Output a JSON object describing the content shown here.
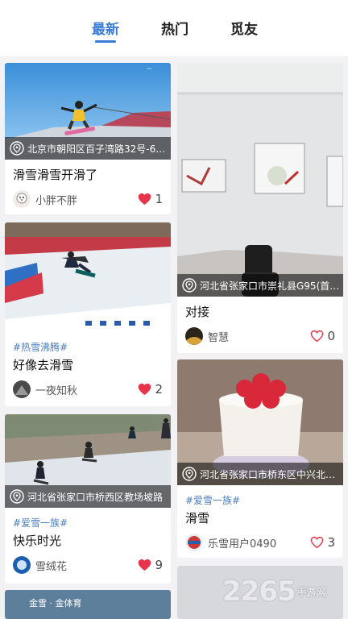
{
  "tabs": [
    {
      "label": "最新",
      "active": true
    },
    {
      "label": "热门",
      "active": false
    },
    {
      "label": "觅友",
      "active": false
    }
  ],
  "colors": {
    "accent": "#3a7bd5",
    "tag": "#4a7dbf",
    "like_filled": "#e8344a",
    "like_outline": "#e8344a"
  },
  "cards_left": [
    {
      "location": "北京市朝阳区百子湾路32号-6…",
      "title": "滑雪滑雪开滑了",
      "author": "小胖不胖",
      "likes": "1",
      "liked": true
    },
    {
      "tag": "#热雪沸腾#",
      "title": "好像去滑雪",
      "author": "一夜知秋",
      "likes": "2",
      "liked": true
    },
    {
      "location": "河北省张家口市桥西区教场坡路",
      "tag": "#爱雪一族#",
      "title": "快乐时光",
      "author": "雪绒花",
      "likes": "9",
      "liked": true
    },
    {
      "image_text": "金雪 · 金体育"
    }
  ],
  "cards_right": [
    {
      "location": "河北省张家口市崇礼县G95(首…",
      "title": "对接",
      "author": "智慧",
      "likes": "0",
      "liked": false
    },
    {
      "location": "河北省张家口市桥东区中兴北路…",
      "tag": "#爱雪一族#",
      "title": "滑雪",
      "author": "乐雪用户0490",
      "likes": "3",
      "liked": false
    }
  ],
  "watermark": {
    "number": "2265",
    "suffix": ".com",
    "sub": "手游网"
  }
}
